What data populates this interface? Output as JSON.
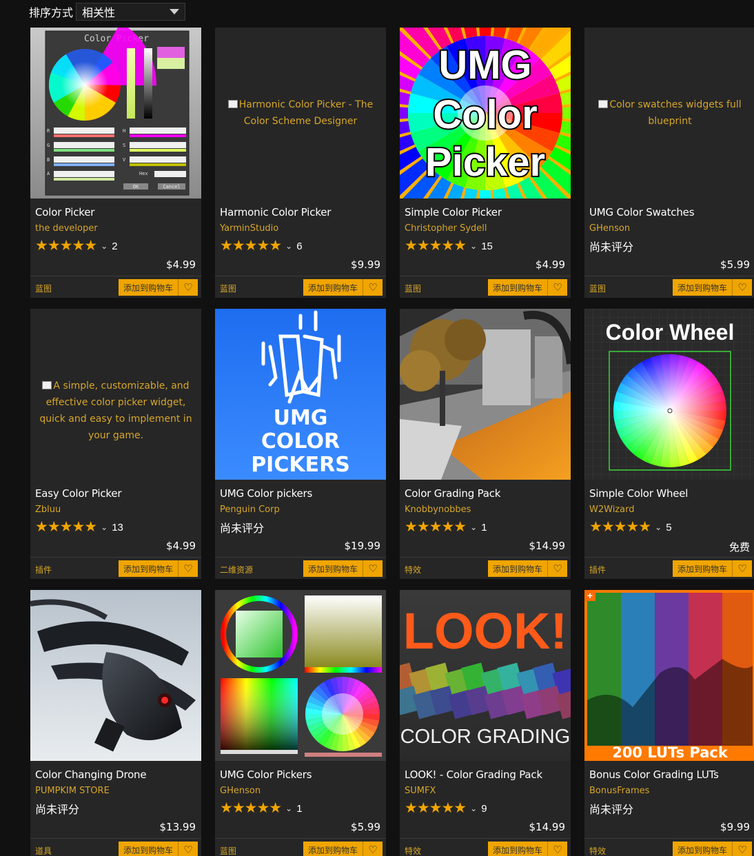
{
  "sort": {
    "label": "排序方式",
    "value": "相关性"
  },
  "cart_label": "添加到购物车",
  "no_rating_text": "尚未评分",
  "products": [
    {
      "title": "Color Picker",
      "author": "the developer",
      "stars": 5,
      "rating_count": "2",
      "price": "$4.99",
      "category": "蓝图",
      "thumb": "colorpicker-ui"
    },
    {
      "title": "Harmonic Color Picker",
      "author": "YarminStudio",
      "stars": 5,
      "rating_count": "6",
      "price": "$9.99",
      "category": "蓝图",
      "thumb": "broken",
      "alt": "Harmonic Color Picker - The Color Scheme Designer"
    },
    {
      "title": "Simple Color Picker",
      "author": "Christopher Sydell",
      "stars": 5,
      "rating_count": "15",
      "price": "$4.99",
      "category": "蓝图",
      "thumb": "umg-rainbow",
      "thumb_text": [
        "UMG",
        "Color",
        "Picker"
      ]
    },
    {
      "title": "UMG Color Swatches",
      "author": "GHenson",
      "stars": 0,
      "rating_count": "",
      "price": "$5.99",
      "category": "蓝图",
      "thumb": "broken",
      "alt": "Color swatches widgets full blueprint"
    },
    {
      "title": "Easy Color Picker",
      "author": "Zbluu",
      "stars": 5,
      "rating_count": "13",
      "price": "$4.99",
      "category": "插件",
      "thumb": "broken",
      "alt": "A simple, customizable, and effective color picker widget, quick and easy to implement in your game."
    },
    {
      "title": "UMG Color pickers",
      "author": "Penguin Corp",
      "stars": 0,
      "rating_count": "",
      "price": "$19.99",
      "category": "二维资源",
      "thumb": "umg-blue",
      "thumb_text": [
        "UMG",
        "COLOR",
        "PICKERS"
      ]
    },
    {
      "title": "Color Grading Pack",
      "author": "Knobbynobbes",
      "stars": 5,
      "rating_count": "1",
      "price": "$14.99",
      "category": "特效",
      "thumb": "interior"
    },
    {
      "title": "Simple Color Wheel",
      "author": "W2Wizard",
      "stars": 5,
      "rating_count": "5",
      "price": "免费",
      "category": "插件",
      "thumb": "color-wheel",
      "thumb_text": [
        "Color Wheel"
      ]
    },
    {
      "title": "Color Changing Drone",
      "author": "PUMPKIM STORE",
      "stars": 0,
      "rating_count": "",
      "price": "$13.99",
      "category": "道具",
      "thumb": "drone"
    },
    {
      "title": "UMG Color Pickers",
      "author": "GHenson",
      "stars": 5,
      "rating_count": "1",
      "price": "$5.99",
      "category": "蓝图",
      "thumb": "pickers-grid"
    },
    {
      "title": "LOOK! - Color Grading Pack",
      "author": "SUMFX",
      "stars": 5,
      "rating_count": "9",
      "price": "$14.99",
      "category": "特效",
      "thumb": "look",
      "thumb_text": [
        "LOOK!",
        "COLOR GRADING"
      ]
    },
    {
      "title": "Bonus Color Grading LUTs",
      "author": "BonusFrames",
      "stars": 0,
      "rating_count": "",
      "price": "$9.99",
      "category": "特效",
      "thumb": "luts",
      "thumb_text": [
        "200 LUTs Pack",
        "+"
      ]
    }
  ]
}
